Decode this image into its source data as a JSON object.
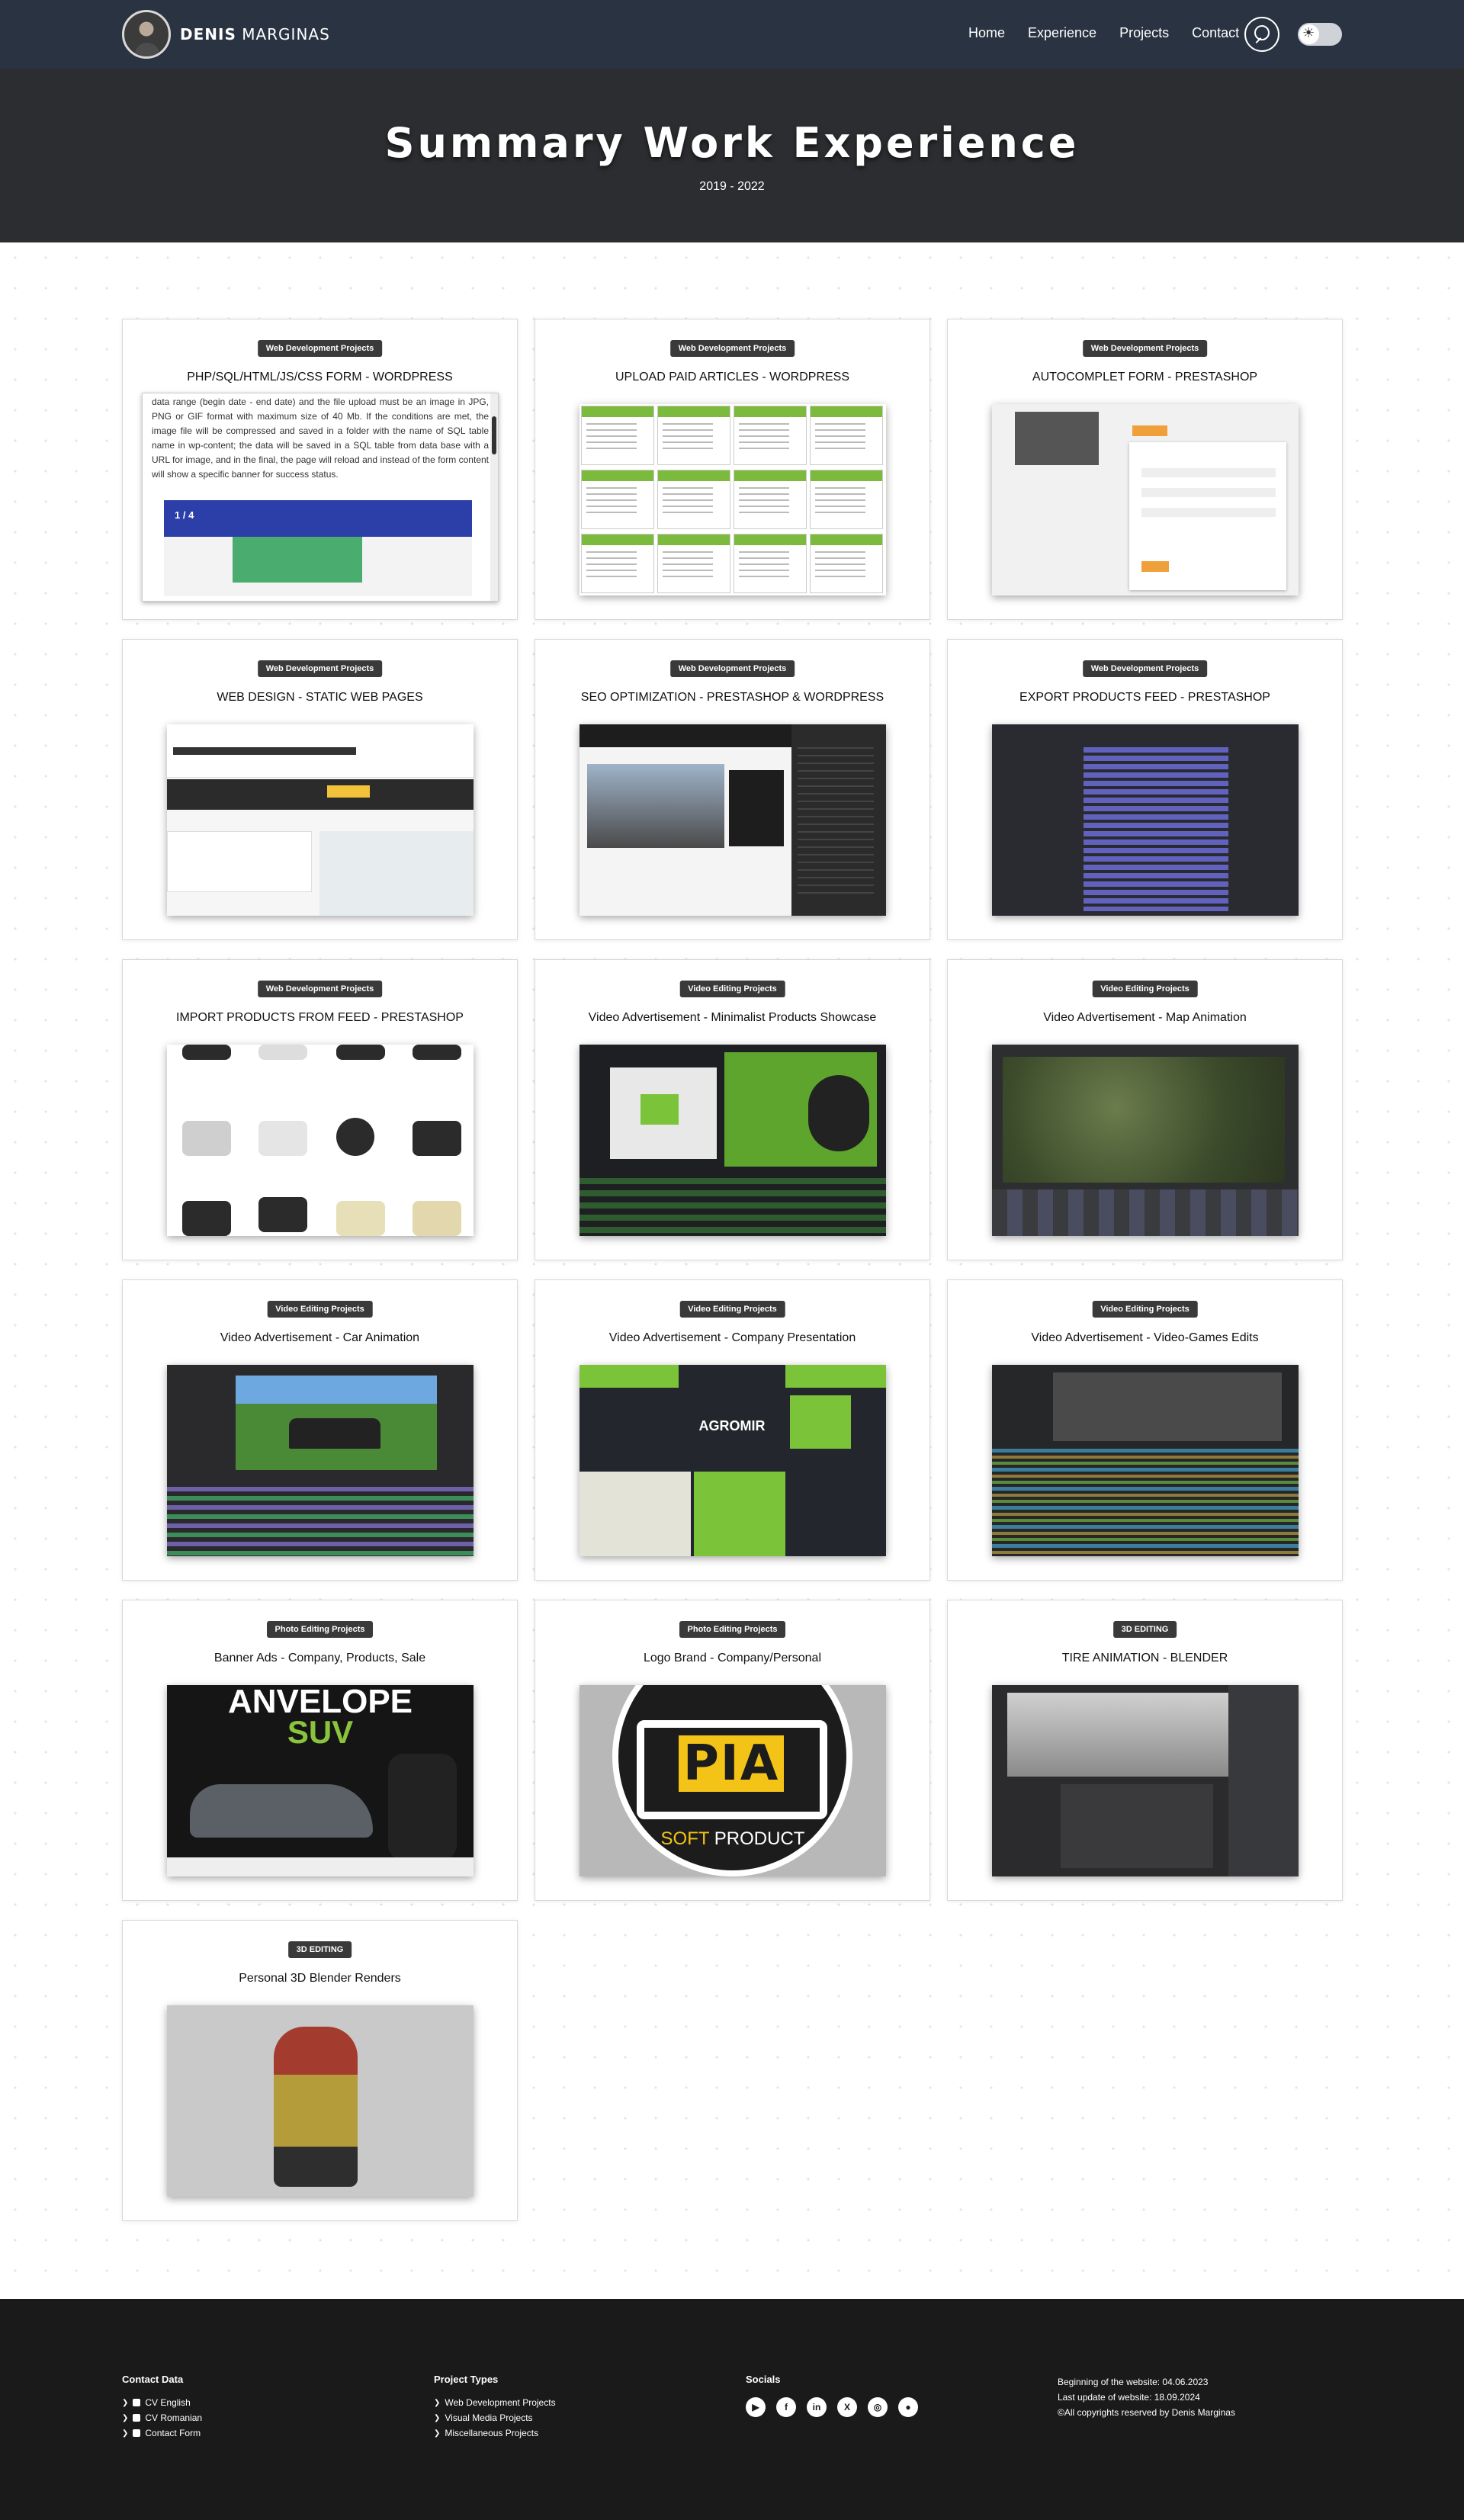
{
  "nav": {
    "brand_first": "DENIS",
    "brand_last": "MARGINAS",
    "links": [
      "Home",
      "Experience",
      "Projects",
      "Contact"
    ]
  },
  "hero": {
    "title": "Summary Work Experience",
    "years": "2019 - 2022"
  },
  "cards": [
    {
      "badge": "Web Development Projects",
      "title": "PHP/SQL/HTML/JS/CSS FORM - WORDPRESS"
    },
    {
      "badge": "Web Development Projects",
      "title": "UPLOAD PAID ARTICLES - WORDPRESS"
    },
    {
      "badge": "Web Development Projects",
      "title": "AUTOCOMPLET FORM - PRESTASHOP"
    },
    {
      "badge": "Web Development Projects",
      "title": "WEB DESIGN - STATIC WEB PAGES"
    },
    {
      "badge": "Web Development Projects",
      "title": "SEO OPTIMIZATION - PRESTASHOP & WORDPRESS"
    },
    {
      "badge": "Web Development Projects",
      "title": "EXPORT PRODUCTS FEED - PRESTASHOP"
    },
    {
      "badge": "Web Development Projects",
      "title": "IMPORT PRODUCTS FROM FEED - PRESTASHOP"
    },
    {
      "badge": "Video Editing Projects",
      "title": "Video Advertisement - Minimalist Products Showcase"
    },
    {
      "badge": "Video Editing Projects",
      "title": "Video Advertisement - Map Animation"
    },
    {
      "badge": "Video Editing Projects",
      "title": "Video Advertisement - Car Animation"
    },
    {
      "badge": "Video Editing Projects",
      "title": "Video Advertisement - Company Presentation"
    },
    {
      "badge": "Video Editing Projects",
      "title": "Video Advertisement - Video-Games Edits"
    },
    {
      "badge": "Photo Editing Projects",
      "title": "Banner Ads - Company, Products, Sale"
    },
    {
      "badge": "Photo Editing Projects",
      "title": "Logo Brand - Company/Personal"
    },
    {
      "badge": "3D EDITING",
      "title": "TIRE ANIMATION - BLENDER"
    },
    {
      "badge": "3D EDITING",
      "title": "Personal 3D Blender Renders"
    }
  ],
  "form_thumb": {
    "text": "data range (begin date - end date) and the file upload must be an image in JPG, PNG or GIF format with maximum size of 40 Mb. If the conditions are met, the image file will be compressed and saved in a folder with the name of SQL table name in wp-content; the data will be saved in a SQL table from data base with a URL for image, and in the final, the page will reload and instead of the form content will show a specific banner for success status.",
    "slide": "1 / 4"
  },
  "logo_thumb": {
    "brand": "PIA",
    "soft": "SOFT",
    "product": "PRODUCT"
  },
  "banner_thumb": {
    "line1": "ANVELOPE",
    "line2": "SUV"
  },
  "company_thumb": {
    "brand": "AGROMIR"
  },
  "footer": {
    "contact_title": "Contact Data",
    "contact_items": [
      "CV English",
      "CV Romanian",
      "Contact Form"
    ],
    "types_title": "Project Types",
    "types_items": [
      "Web Development Projects",
      "Visual Media Projects",
      "Miscellaneous Projects"
    ],
    "socials_title": "Socials",
    "social_icons": [
      "youtube-icon",
      "facebook-icon",
      "linkedin-icon",
      "x-icon",
      "instagram-icon",
      "github-icon"
    ],
    "begin": "Beginning of the website: 04.06.2023",
    "update": "Last update of website: 18.09.2024",
    "rights": "©All copyrights reserved by Denis Marginas"
  },
  "colors": {
    "nav_bg": "#2a3342",
    "hero_bg": "#2c2d30",
    "badge_bg": "#3a3a3a",
    "footer_bg": "#1a1a1a"
  }
}
